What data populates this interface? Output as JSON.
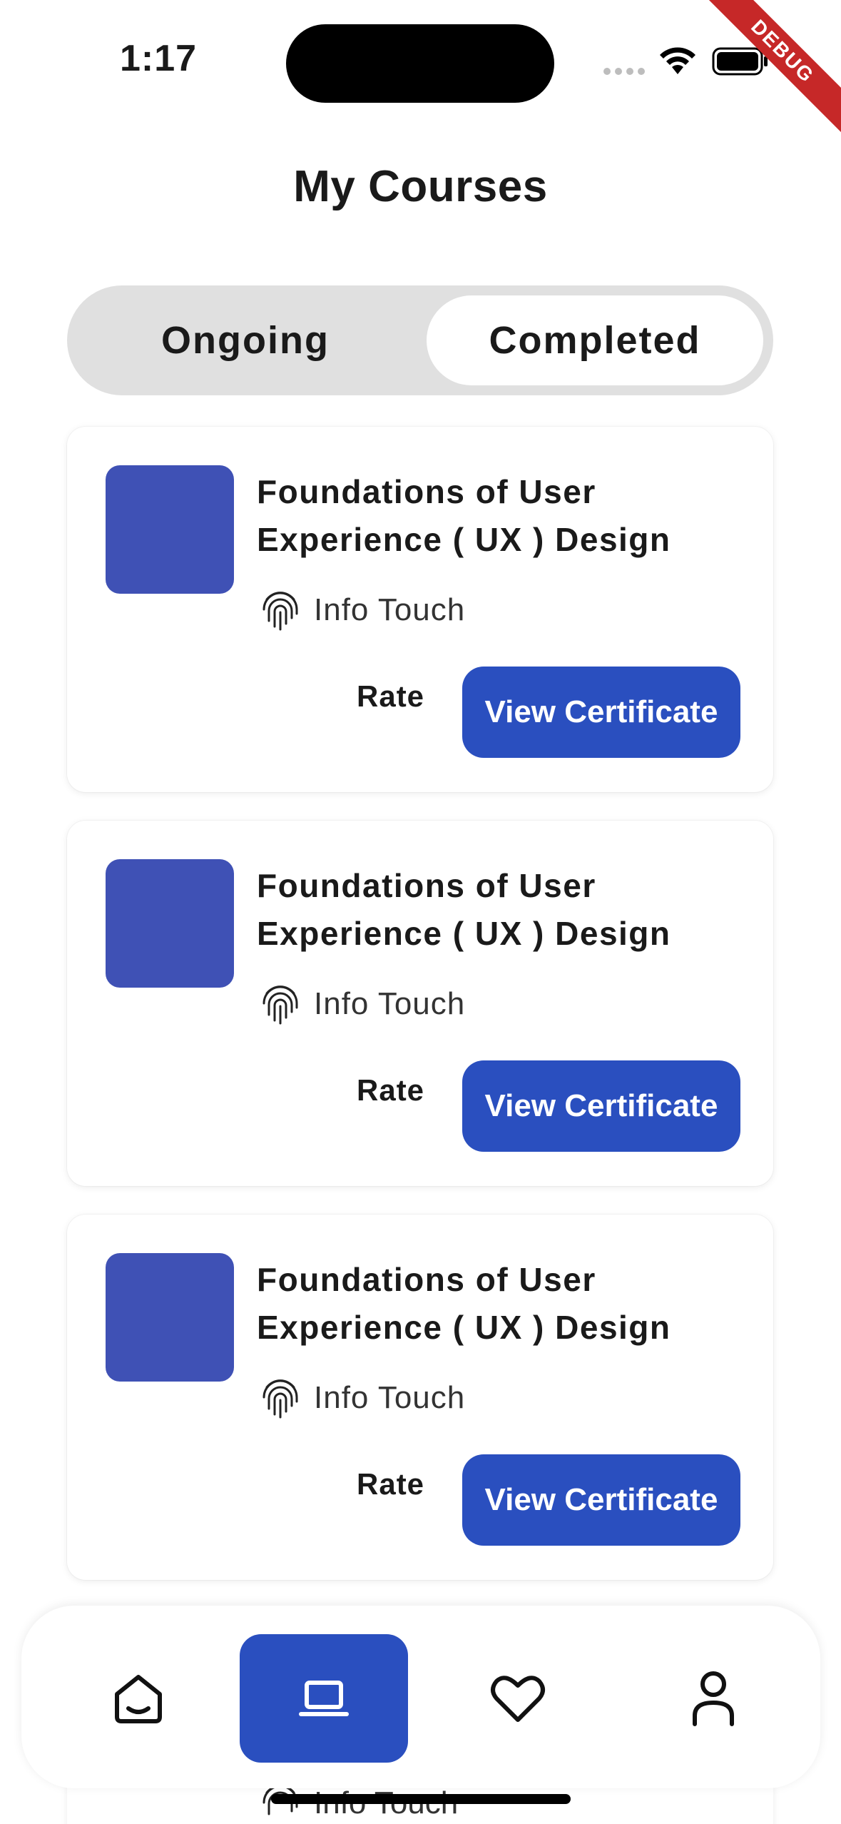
{
  "status_bar": {
    "time": "1:17",
    "debug_label": "DEBUG"
  },
  "header": {
    "title": "My Courses"
  },
  "tabs": [
    {
      "label": "Ongoing",
      "selected": false
    },
    {
      "label": "Completed",
      "selected": true
    }
  ],
  "courses": [
    {
      "title": "Foundations of User Experience ( UX ) Design",
      "provider": "Info Touch",
      "rate_label": "Rate",
      "certificate_label": "View Certificate",
      "thumbnail_color": "#3f51b5"
    },
    {
      "title": "Foundations of User Experience ( UX ) Design",
      "provider": "Info Touch",
      "rate_label": "Rate",
      "certificate_label": "View Certificate",
      "thumbnail_color": "#3f51b5"
    },
    {
      "title": "Foundations of User Experience ( UX ) Design",
      "provider": "Info Touch",
      "rate_label": "Rate",
      "certificate_label": "View Certificate",
      "thumbnail_color": "#3f51b5"
    }
  ],
  "partial_course": {
    "provider": "Info Touch"
  },
  "bottom_nav": [
    {
      "icon": "home-icon",
      "active": false
    },
    {
      "icon": "laptop-icon",
      "active": true
    },
    {
      "icon": "heart-icon",
      "active": false
    },
    {
      "icon": "user-icon",
      "active": false
    }
  ],
  "colors": {
    "accent": "#2a4fbf",
    "thumbnail": "#3f51b5",
    "segment_bg": "#e0e0e0"
  }
}
